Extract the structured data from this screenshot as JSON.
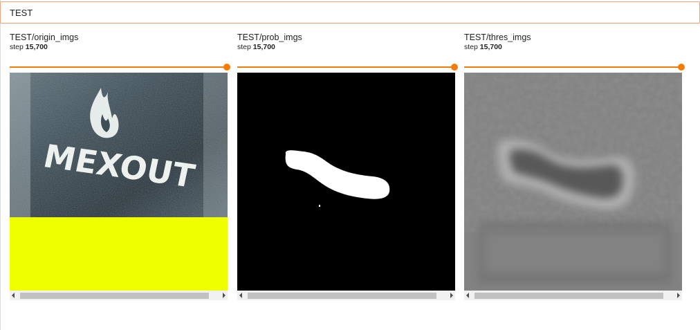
{
  "header": {
    "title": "TEST"
  },
  "cards": [
    {
      "title": "TEST/origin_imgs",
      "step_prefix": "step",
      "step_value": "15,700",
      "logo_text": "MEXOUT"
    },
    {
      "title": "TEST/prob_imgs",
      "step_prefix": "step",
      "step_value": "15,700"
    },
    {
      "title": "TEST/thres_imgs",
      "step_prefix": "step",
      "step_value": "15,700"
    }
  ],
  "colors": {
    "accent": "#f57c00",
    "header_border": "#f0a27a",
    "yellow_fill": "#eeff00"
  },
  "slider_position_fraction": 1.0
}
